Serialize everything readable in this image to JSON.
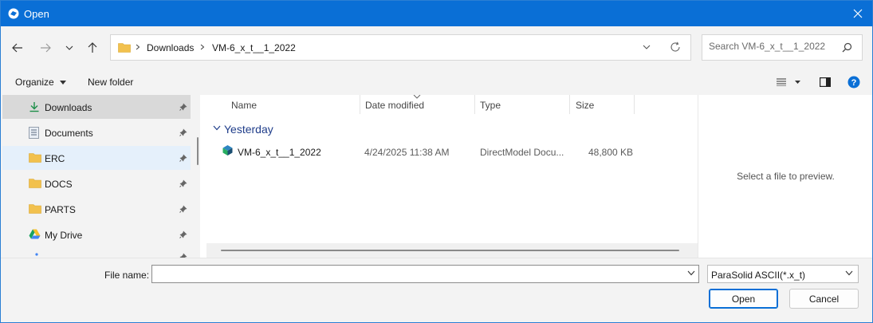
{
  "window": {
    "title": "Open"
  },
  "address": {
    "crumbs": [
      "Downloads",
      "VM-6_x_t__1_2022"
    ]
  },
  "search": {
    "placeholder": "Search VM-6_x_t__1_2022"
  },
  "toolbar": {
    "organize_label": "Organize",
    "new_folder_label": "New folder"
  },
  "nav": {
    "items": [
      {
        "label": "Downloads",
        "icon": "download-icon"
      },
      {
        "label": "Documents",
        "icon": "document-icon"
      },
      {
        "label": "ERC",
        "icon": "folder-icon"
      },
      {
        "label": "DOCS",
        "icon": "folder-icon"
      },
      {
        "label": "PARTS",
        "icon": "folder-icon"
      },
      {
        "label": "My Drive",
        "icon": "google-drive-icon"
      }
    ]
  },
  "files": {
    "columns": [
      "Name",
      "Date modified",
      "Type",
      "Size"
    ],
    "group_label": "Yesterday",
    "rows": [
      {
        "name": "VM-6_x_t__1_2022",
        "date": "4/24/2025 11:38 AM",
        "type": "DirectModel Docu...",
        "size": "48,800 KB"
      }
    ]
  },
  "preview": {
    "message": "Select a file to preview."
  },
  "bottom": {
    "filename_label": "File name:",
    "filename_value": "",
    "filetype_value": "ParaSolid ASCII(*.x_t)",
    "open_label": "Open",
    "cancel_label": "Cancel"
  },
  "colors": {
    "titlebar": "#0a6fd6",
    "accent": "#0a6fd6",
    "folder": "#f2c14e",
    "group_text": "#1f3d8a"
  }
}
